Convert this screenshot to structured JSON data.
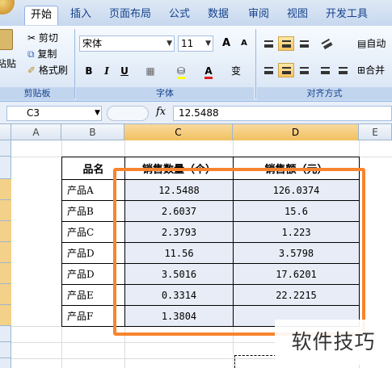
{
  "tabs": [
    "开始",
    "插入",
    "页面布局",
    "公式",
    "数据",
    "审阅",
    "视图",
    "开发工具"
  ],
  "ribbon": {
    "clipboard": {
      "cut": "剪切",
      "copy": "复制",
      "format_painter": "格式刷",
      "paste": "粘贴",
      "group_label": "剪贴板"
    },
    "font": {
      "name": "宋体",
      "size": "11",
      "bold": "B",
      "italic": "I",
      "underline": "U",
      "group_label": "字体",
      "grow": "A",
      "shrink": "A",
      "phonetic": "变",
      "font_color_letter": "A"
    },
    "alignment": {
      "wrap": "自动",
      "merge": "合并",
      "group_label": "对齐方式"
    }
  },
  "formula_bar": {
    "cell_ref": "C3",
    "fx": "fx",
    "value": "12.5488"
  },
  "columns": [
    "A",
    "B",
    "C",
    "D",
    "E"
  ],
  "table": {
    "headers": [
      "品名",
      "销售数量（个）",
      "销售额（元）"
    ],
    "rows": [
      {
        "name": "产品A",
        "qty": "12.5488",
        "amount": "126.0374"
      },
      {
        "name": "产品B",
        "qty": "2.6037",
        "amount": "15.6"
      },
      {
        "name": "产品C",
        "qty": "2.3793",
        "amount": "1.223"
      },
      {
        "name": "产品D",
        "qty": "11.56",
        "amount": "3.5798"
      },
      {
        "name": "产品D",
        "qty": "3.5016",
        "amount": "17.6201"
      },
      {
        "name": "产品E",
        "qty": "0.3314",
        "amount": "22.2215"
      },
      {
        "name": "产品F",
        "qty": "1.3804",
        "amount": ""
      }
    ]
  },
  "watermark": "软件技巧",
  "colors": {
    "highlight": "#f7842d",
    "ribbon_text": "#15428b"
  }
}
